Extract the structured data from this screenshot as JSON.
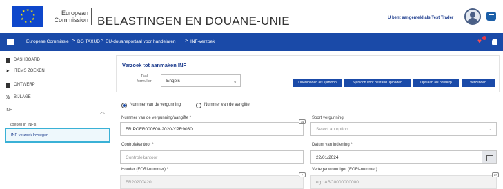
{
  "header": {
    "org_line1": "European",
    "org_line2": "Commission",
    "site_title": "BELASTINGEN EN DOUANE-UNIE",
    "user_status": "U bent aangemeld als Test Trader"
  },
  "breadcrumb": {
    "items": [
      "Europese Commissie",
      "DG TAXUD",
      "EU-douaneportaal voor handelaren",
      "INF-verzoek"
    ],
    "separator": ">"
  },
  "sidebar": {
    "items": [
      {
        "label": "DASHBOARD",
        "icon": "dashboard-icon"
      },
      {
        "label": "ITEMS ZOEKEN",
        "icon": "arrow-right-icon"
      },
      {
        "label": "ONTWERP",
        "icon": "document-icon"
      },
      {
        "label": "BIJLAGE",
        "icon": "paperclip-icon"
      },
      {
        "label": "INF",
        "icon": "chevron-up-icon"
      }
    ],
    "subitems": [
      "Zoeken in INF's",
      "INF-verzoek Invoegen"
    ]
  },
  "form": {
    "title": "Verzoek tot aanmaken INF",
    "language_label_line1": "Taal",
    "language_label_line2": "formulier",
    "language_value": "Engels",
    "buttons": [
      "Downloaden als sjabloon",
      "Sjabloon voor bestand uploaden",
      "Opslaan als ontwerp",
      "Verzenden"
    ],
    "radio_options": [
      "Nummer van de vergunning",
      "Nummer van de aangifte"
    ],
    "radio_selected": 0,
    "fields": {
      "number": {
        "label": "Nummer van de vergunning/aangifte *",
        "value": "FRIPOFR000600-2020-YPR9030",
        "counter": "34"
      },
      "type": {
        "label": "Soort vergunning",
        "placeholder": "Select an option"
      },
      "office": {
        "label": "Controlekantoor *",
        "placeholder": "Controlekantoor"
      },
      "date": {
        "label": "Datum van indiening *",
        "value": "22/01/2024"
      },
      "holder": {
        "label": "Houder (EORI-nummer) *",
        "value": "FR20200420",
        "counter": "7"
      },
      "representative": {
        "label": "Vertegenwoordiger (EORI-nummer)",
        "placeholder": "eg : ABC0000000000",
        "counter": "17"
      }
    }
  },
  "colors": {
    "primary": "#1a4aa8",
    "highlight": "#3ab1d6",
    "title": "#1a3a8c"
  }
}
